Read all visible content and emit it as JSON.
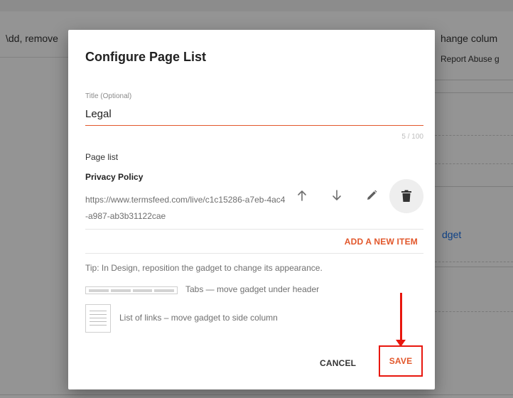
{
  "background": {
    "left_text": "\\dd, remove",
    "right_text": "hange colum",
    "right_sub": "Report Abuse g",
    "right_link": "dget"
  },
  "dialog": {
    "title": "Configure Page List",
    "title_field": {
      "label": "Title (Optional)",
      "value": "Legal",
      "counter": "5 / 100"
    },
    "page_list": {
      "label": "Page list",
      "items": [
        {
          "title": "Privacy Policy",
          "url": "https://www.termsfeed.com/live/c1c15286-a7eb-4ac4-a987-ab3b31122cae"
        }
      ],
      "add_label": "ADD A NEW ITEM"
    },
    "tip": "Tip: In Design, reposition the gadget to change its appearance.",
    "options": {
      "tabs_text": "Tabs — move gadget under header",
      "list_text": "List of links – move gadget to side column"
    },
    "buttons": {
      "cancel": "CANCEL",
      "save": "SAVE"
    }
  },
  "icons": {
    "up": "arrow-up-icon",
    "down": "arrow-down-icon",
    "edit": "pencil-icon",
    "delete": "trash-icon"
  },
  "colors": {
    "accent": "#e2572b",
    "annotation": "#e8170e"
  }
}
